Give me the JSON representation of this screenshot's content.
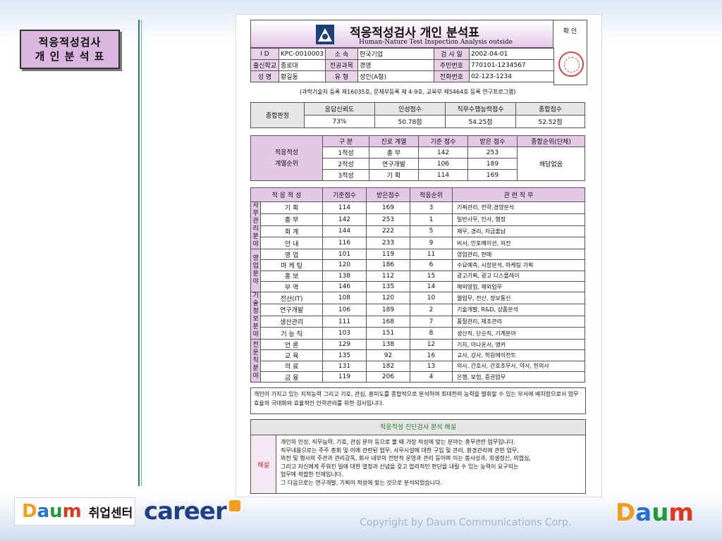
{
  "slide_title": [
    "적응적성검사",
    "개 인 분 석 표"
  ],
  "header": {
    "title": "적응적성검사  개인 분석표",
    "subtitle": "Human-Nature Test Inspection Analysis outside",
    "confirm": "확  인"
  },
  "info": {
    "rows": [
      [
        "I    D",
        "KPC-0010003",
        "소      속",
        "한국기업",
        "검 사 일",
        "2002-04-01"
      ],
      [
        "출신학교",
        "종로대",
        "전공과목",
        "경영",
        "주민번호",
        "770101-1234567"
      ],
      [
        "성      명",
        "황길동",
        "유      형",
        "성인(A형)",
        "전화번호",
        "02-123-1234"
      ]
    ],
    "cert": "(과학기술처 등록 제16035호, 문체부등록 제 4-9호, 교육부 제5464호 등록 연구프로그램)"
  },
  "summary": {
    "label": "종합판정",
    "headers": [
      "응답신뢰도",
      "인성점수",
      "직무수행능력점수",
      "종합점수"
    ],
    "values": [
      "73%",
      "50.78점",
      "54.25점",
      "52.52점"
    ]
  },
  "rank": {
    "label": [
      "적응적성",
      "계열순위"
    ],
    "headers": [
      "구    분",
      "진로 계열",
      "기준 점수",
      "받은 점수",
      "종합순위(단체)"
    ],
    "rows": [
      [
        "1적성",
        "총      무",
        "142",
        "253"
      ],
      [
        "2적성",
        "연구개발",
        "106",
        "189"
      ],
      [
        "3적성",
        "기      획",
        "114",
        "169"
      ]
    ],
    "group_rank": "해당없음"
  },
  "main": {
    "headers": [
      "적 응 적 성",
      "기준점수",
      "받은점수",
      "적응순위",
      "관 련 직 무"
    ],
    "groups": [
      {
        "category": "사무관리분야",
        "rows": [
          [
            "기      획",
            "114",
            "169",
            "3",
            "기획관리, 전략,경영분석"
          ],
          [
            "총      무",
            "142",
            "253",
            "1",
            "일반사무, 인사, 행정"
          ],
          [
            "회      계",
            "144",
            "222",
            "5",
            "재무, 경리, 자금출납"
          ],
          [
            "안      내",
            "116",
            "233",
            "9",
            "비서, 인포메이션, 의전"
          ]
        ]
      },
      {
        "category": "영업분야",
        "rows": [
          [
            "영      업",
            "101",
            "119",
            "11",
            "영업관리, 판매"
          ],
          [
            "마 케 팅",
            "120",
            "186",
            "6",
            "수요예측, 시장분석, 마케팅 기획"
          ],
          [
            "홍      보",
            "138",
            "112",
            "15",
            "광고기획, 광고 디스플레이"
          ],
          [
            "무      역",
            "146",
            "135",
            "14",
            "해외영업, 해외업무"
          ]
        ]
      },
      {
        "category": "기술정보분야",
        "rows": [
          [
            "전산(IT)",
            "108",
            "120",
            "10",
            "웹업무, 전산, 정보통신"
          ],
          [
            "연구개발",
            "106",
            "189",
            "2",
            "기술개발, R&D, 상품분석"
          ],
          [
            "생산관리",
            "111",
            "168",
            "7",
            "품질관리, 제조관리"
          ],
          [
            "기 능 직",
            "103",
            "151",
            "8",
            "생산직, 단순직, 기계분야"
          ]
        ]
      },
      {
        "category": "전문직분야",
        "rows": [
          [
            "언      론",
            "129",
            "138",
            "12",
            "기자, 아나운서, 앵커"
          ],
          [
            "교      육",
            "135",
            "92",
            "16",
            "교사, 강사, 학원에이전트"
          ],
          [
            "의      료",
            "131",
            "182",
            "13",
            "의사, 간호사, 간호조무사, 약사, 한의사"
          ],
          [
            "금      융",
            "119",
            "206",
            "4",
            "은행, 보험, 증권업무"
          ]
        ]
      }
    ]
  },
  "note": "개인이 가지고 있는 지적능력 그리고 기호, 관심, 흥미도를 종합적으로 분석하여 최대한의 능력을 발휘할 수 있는 부서에 배치함으로서 업무효율의 극대화와 효율적인 인력관리를 위한 검사입니다.",
  "analysis": {
    "title": "적응적성 진단검사 분석 해설",
    "side": "해설",
    "lines": [
      "개인의 인성, 직무능력, 기호, 관심 분야 등으로 볼 때 가장 적성에 맞는 분야는 총무관련 업무입니다.",
      "직무내용으로는 주주 총회 및 이에 관련된 업무, 사무시설에 대한 구입 및 관리, 환경관리에 관한 업무,",
      "의전 및 행사의 주관과 관리감독, 회사 내부의 전반적 운영과 관리 등이며 이는 봉사성과, 희생정신, 의협심,",
      "그리고 자신에게 주워진 일에 대한 열정과 신념을 갖고 합리적인 판단을 내릴 수 있는 능력이 요구되는",
      "업무에 적합한 인재입니다.",
      "그 다음으로는 연구개발, 기획이 적성에 맞는 것으로 분석되었습니다."
    ]
  },
  "footer": {
    "daum_letters": [
      "D",
      "a",
      "u",
      "m"
    ],
    "job_center": "취업센터",
    "career": "career",
    "copyright": "Copyright by Daum Communications Corp."
  },
  "colors": {
    "accent_purple": "#e3c9e5",
    "title_box": "#d9b6de",
    "analysis_title": "#2b7b2b",
    "stamp": "#d24444"
  }
}
